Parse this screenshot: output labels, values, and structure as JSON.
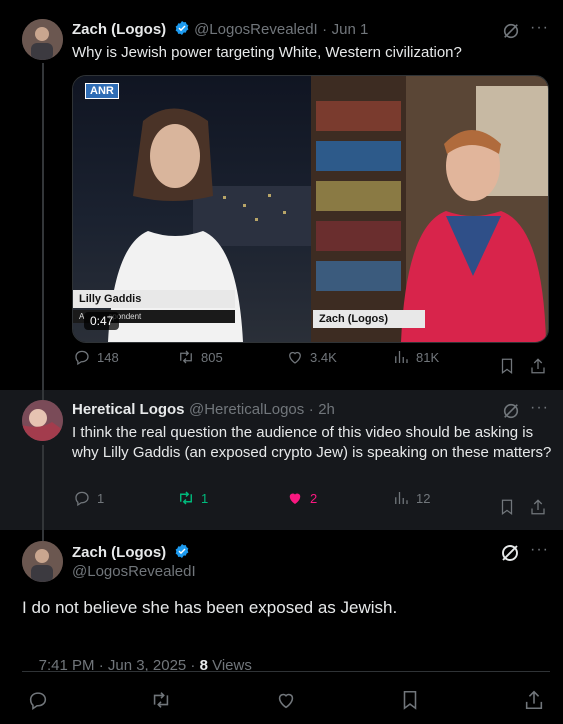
{
  "tweet1": {
    "name": "Zach (Logos)",
    "handle": "@LogosRevealedI",
    "sep": "·",
    "date": "Jun 1",
    "text": "Why is Jewish power targeting White, Western civilization?",
    "video": {
      "logo": "ANR",
      "left_caption": "Lilly Gaddis",
      "left_subcaption": "A           spondent",
      "right_caption": "Zach (Logos)",
      "timer": "0:47"
    },
    "stats": {
      "replies": "148",
      "reposts": "805",
      "likes": "3.4K",
      "views": "81K"
    }
  },
  "tweet2": {
    "name": "Heretical Logos",
    "handle": "@HereticalLogos",
    "sep": "·",
    "date": "2h",
    "text": "I think the real question the audience of this video should be asking is why Lilly Gaddis (an exposed crypto Jew) is speaking on these matters?",
    "stats": {
      "replies": "1",
      "reposts": "1",
      "likes": "2",
      "views": "12"
    },
    "colors": {
      "repost": "#00ba7c",
      "like": "#f91880"
    }
  },
  "main": {
    "name": "Zach (Logos)",
    "handle": "@LogosRevealedI",
    "text": "I do not believe she has been exposed as Jewish.",
    "time": "7:41 PM · Jun 3, 2025 · ",
    "views_count": "8",
    "views_label": " Views"
  },
  "colors": {
    "verified": "#1d9bf0",
    "muted": "#71767b",
    "text": "#e7e9ea"
  },
  "icons": [
    "grok-icon",
    "more-icon",
    "reply-icon",
    "repost-icon",
    "like-icon",
    "views-icon",
    "bookmark-icon",
    "share-icon",
    "verified-icon"
  ]
}
